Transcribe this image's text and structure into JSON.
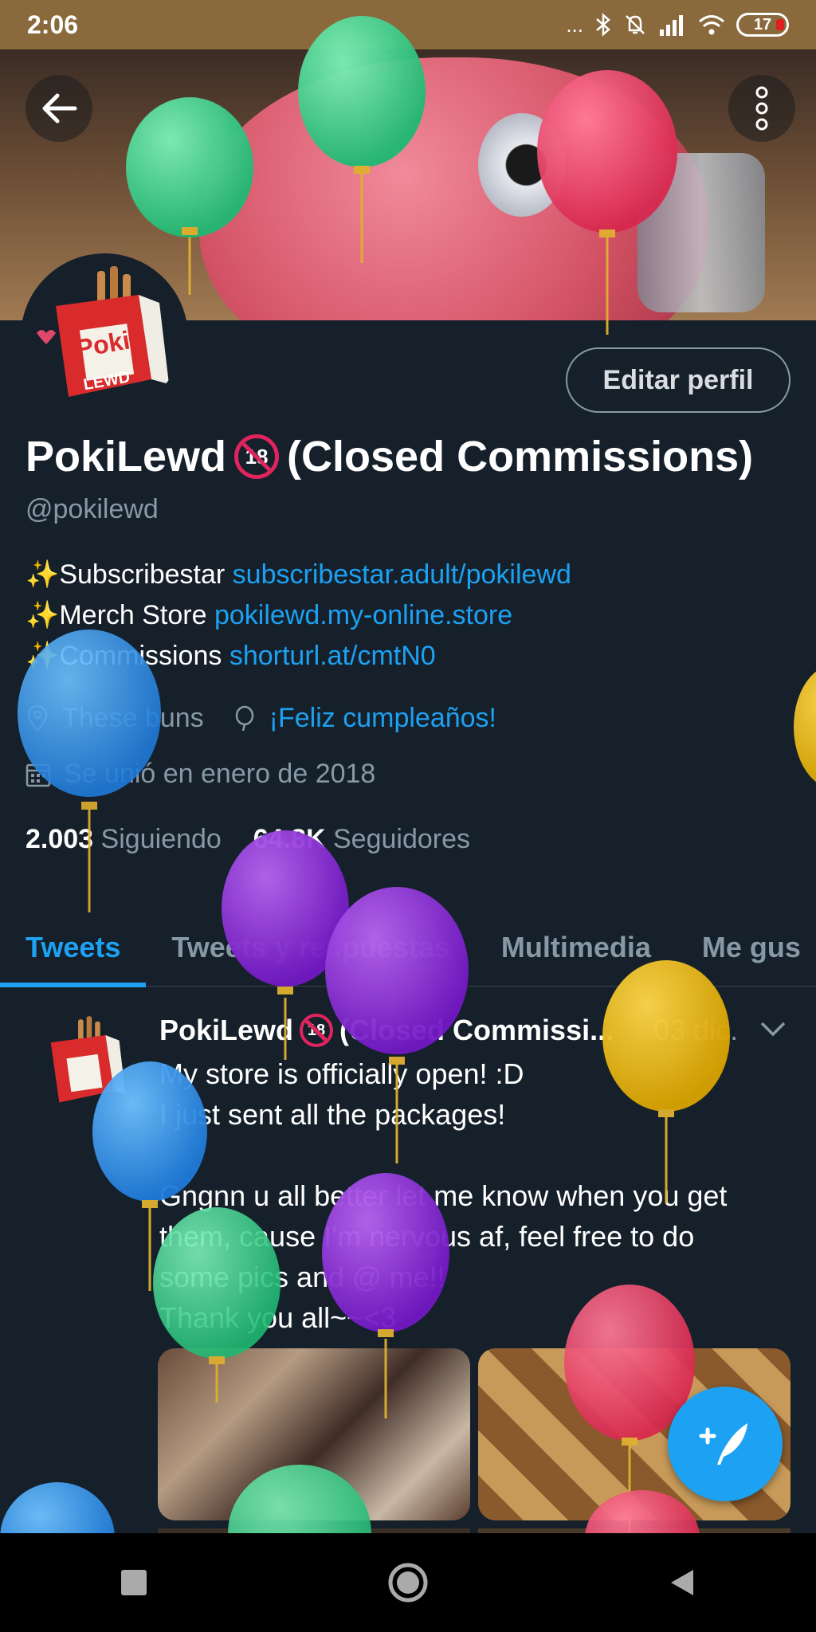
{
  "status_bar": {
    "time": "2:06",
    "battery": "17",
    "dots": "...",
    "icons": [
      "bluetooth-icon",
      "mute-icon",
      "signal-icon",
      "wifi-icon",
      "battery-icon"
    ]
  },
  "profile": {
    "edit_button": "Editar perfil",
    "name": "PokiLewd",
    "name_suffix": "(Closed Commissions)",
    "badge": "18",
    "handle": "@pokilewd",
    "bio": [
      {
        "emoji": "✨",
        "label": "Subscribestar ",
        "link": "subscribestar.adult/pokilewd"
      },
      {
        "emoji": "✨",
        "label": "Merch Store ",
        "link": "pokilewd.my-online.store"
      },
      {
        "emoji": "✨",
        "label": "Commissions ",
        "link": "shorturl.at/cmtN0"
      }
    ],
    "location": "These buns",
    "birthday": "¡Feliz cumpleaños!",
    "joined": "Se unió en enero de 2018",
    "following_count": "2.003",
    "following_label": "Siguiendo",
    "followers_count": "64.8K",
    "followers_label": "Seguidores"
  },
  "tabs": [
    "Tweets",
    "Tweets y respuestas",
    "Multimedia",
    "Me gus"
  ],
  "tweet": {
    "name": "PokiLewd",
    "name_suffix": "(Closed Commissi...",
    "badge": "18",
    "date": "· 03 dic.",
    "lines": [
      "My store is officially open! :D",
      "I just sent all the packages!",
      "",
      "Gngnn u all better let me know when you get",
      "them, cause I'm nervous af, feel free to do",
      "some pics and @ me!!",
      "Thank you all~~<3"
    ]
  },
  "avatar_text": {
    "brand_top": "Poki",
    "brand_bottom": "LEWD"
  },
  "colors": {
    "accent": "#1da1f2",
    "background": "#15202b",
    "muted": "#8899a6",
    "status_bar": "#8a6a3c"
  }
}
